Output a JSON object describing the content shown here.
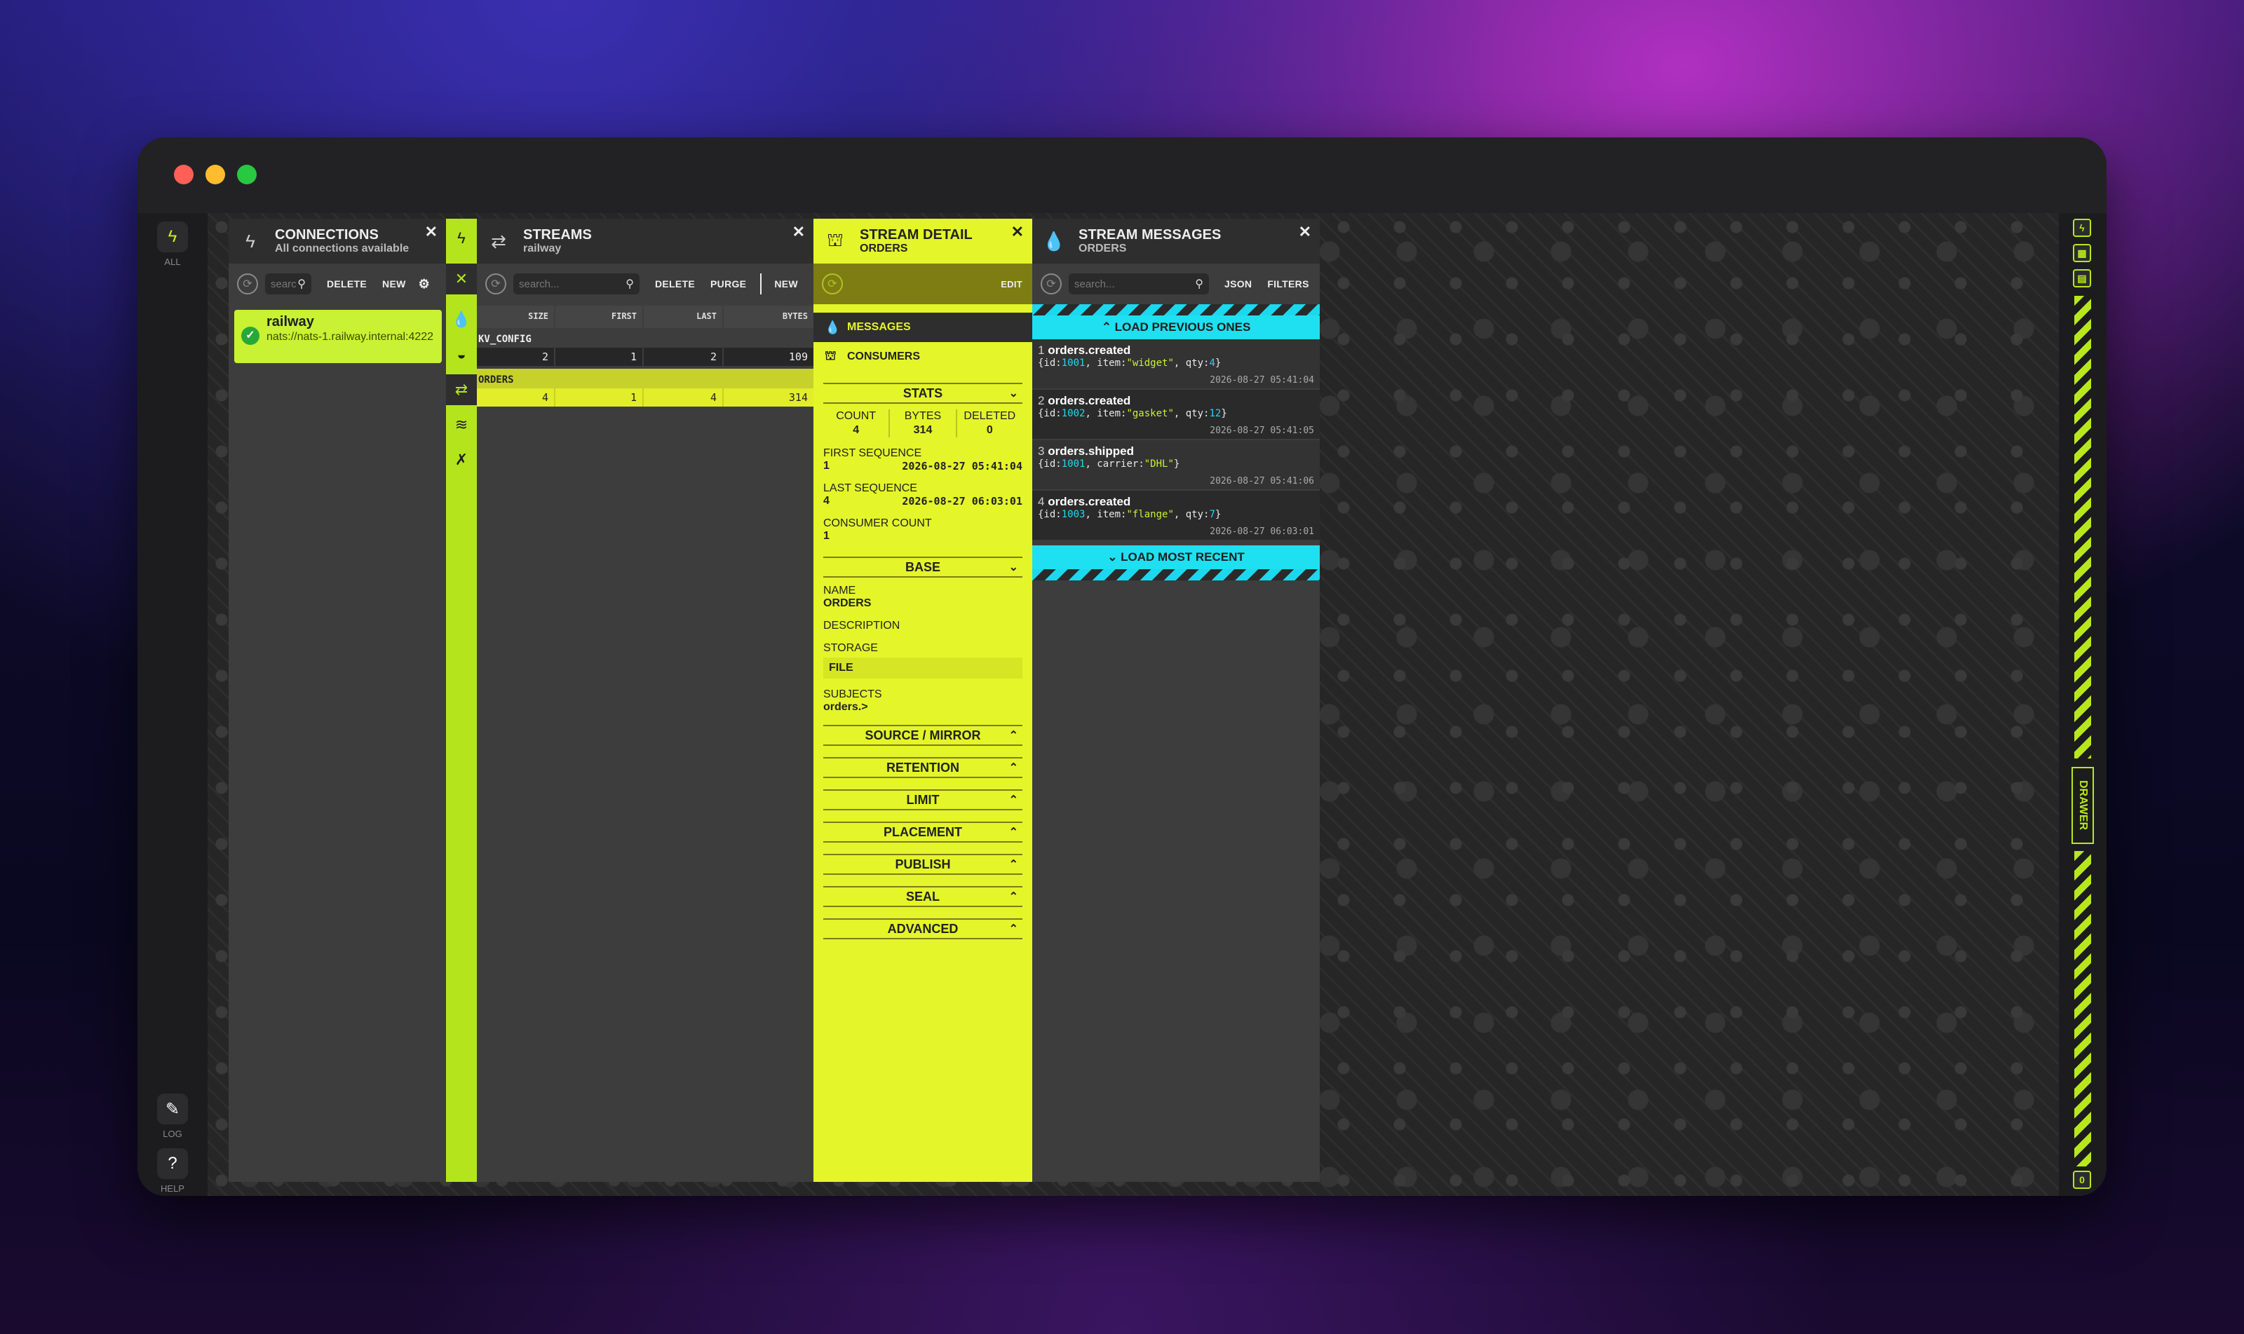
{
  "leftbar": {
    "all_label": "ALL",
    "log_label": "LOG",
    "help_label": "HELP",
    "help_glyph": "?"
  },
  "rightbar": {
    "drawer_label": "DRAWER",
    "counter": "0"
  },
  "connections": {
    "title": "CONNECTIONS",
    "subtitle": "All connections available",
    "search_placeholder": "search...",
    "delete_label": "DELETE",
    "new_label": "NEW",
    "item": {
      "name": "railway",
      "url": "nats://nats-1.railway.internal:4222"
    }
  },
  "streams": {
    "title": "STREAMS",
    "subtitle": "railway",
    "search_placeholder": "search...",
    "delete_label": "DELETE",
    "purge_label": "PURGE",
    "new_label": "NEW",
    "columns": [
      "SIZE",
      "FIRST",
      "LAST",
      "BYTES"
    ],
    "rows": [
      {
        "name": "KV_CONFIG",
        "size": "2",
        "first": "1",
        "last": "2",
        "bytes": "109"
      },
      {
        "name": "ORDERS",
        "size": "4",
        "first": "1",
        "last": "4",
        "bytes": "314"
      }
    ]
  },
  "detail": {
    "title": "STREAM DETAIL",
    "subtitle": "ORDERS",
    "edit_label": "EDIT",
    "menu": [
      "MESSAGES",
      "CONSUMERS"
    ],
    "stats_label": "STATS",
    "stats": [
      {
        "label": "COUNT",
        "value": "4"
      },
      {
        "label": "BYTES",
        "value": "314"
      },
      {
        "label": "DELETED",
        "value": "0"
      }
    ],
    "first_sequence": {
      "label": "FIRST SEQUENCE",
      "value": "1",
      "date": "2026-08-27 05:41:04"
    },
    "last_sequence": {
      "label": "LAST SEQUENCE",
      "value": "4",
      "date": "2026-08-27 06:03:01"
    },
    "consumer_count": {
      "label": "CONSUMER COUNT",
      "value": "1"
    },
    "base_label": "BASE",
    "name": {
      "label": "NAME",
      "value": "ORDERS"
    },
    "description": {
      "label": "DESCRIPTION"
    },
    "storage": {
      "label": "STORAGE",
      "value": "FILE"
    },
    "subjects": {
      "label": "SUBJECTS",
      "value": "orders.>"
    },
    "sections": [
      "SOURCE / MIRROR",
      "RETENTION",
      "LIMIT",
      "PLACEMENT",
      "PUBLISH",
      "SEAL",
      "ADVANCED"
    ]
  },
  "messages": {
    "title": "STREAM MESSAGES",
    "subtitle": "ORDERS",
    "search_placeholder": "search...",
    "json_label": "JSON",
    "filters_label": "FILTERS",
    "load_previous": "LOAD PREVIOUS ONES",
    "load_recent": "LOAD MOST RECENT",
    "items": [
      {
        "seq": "1",
        "subject": "orders.created",
        "id": "1001",
        "key": "item",
        "val": "\"widget\"",
        "key2": "qty",
        "val2": "4",
        "ts": "2026-08-27 05:41:04"
      },
      {
        "seq": "2",
        "subject": "orders.created",
        "id": "1002",
        "key": "item",
        "val": "\"gasket\"",
        "key2": "qty",
        "val2": "12",
        "ts": "2026-08-27 05:41:05"
      },
      {
        "seq": "3",
        "subject": "orders.shipped",
        "id": "1001",
        "key": "carrier",
        "val": "\"DHL\"",
        "key2": "",
        "val2": "",
        "ts": "2026-08-27 05:41:06"
      },
      {
        "seq": "4",
        "subject": "orders.created",
        "id": "1003",
        "key": "item",
        "val": "\"flange\"",
        "key2": "qty",
        "val2": "7",
        "ts": "2026-08-27 06:03:01"
      }
    ]
  },
  "colors": {
    "accent": "#e4f52a",
    "lime": "#b4e51c",
    "cyan": "#1fe0f0",
    "panel": "#3d3d3d"
  }
}
